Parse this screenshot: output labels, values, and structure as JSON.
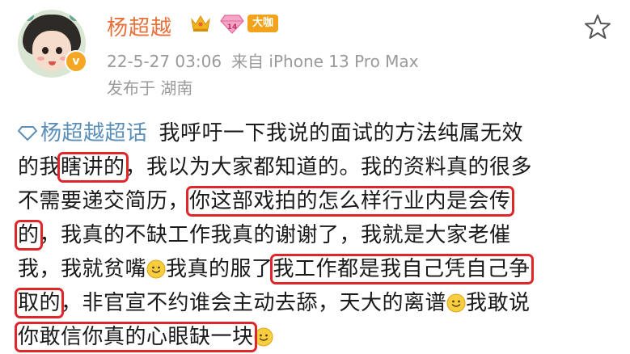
{
  "user": {
    "name": "杨超越",
    "vip_badge": "大咖",
    "level_badge": "14",
    "verified_mark": "v"
  },
  "meta": {
    "timestamp": "22-5-27 03:06",
    "source": "来自 iPhone 13 Pro Max",
    "location": "发布于 湖南"
  },
  "post": {
    "topic": "杨超越超话",
    "lines": [
      [
        "我呼吁一下我说的面试的方法纯属无效"
      ],
      [
        "的我",
        "瞎讲的",
        "，我以为大家都知道的。我的资料真的很多"
      ],
      [
        "不需要递交简历，",
        "你这部戏拍的怎么样行业内是会传"
      ],
      [
        "的",
        "，我真的不缺工作我真的谢谢了，我就是大家老催"
      ],
      [
        "我，我就贫嘴",
        "我真的服了",
        "我工作都是我自己凭自己争"
      ],
      [
        "取的",
        "，非官宣不约谁会主动去舔，天大的离谱",
        "我敢说"
      ],
      [
        "你敢信你真的心眼缺一块"
      ]
    ]
  },
  "colors": {
    "username": "#e8713a",
    "topic": "#5b8fb9",
    "highlight_box": "#e0262a",
    "meta_text": "#9a9a9a"
  },
  "icons": {
    "favorite": "star-outline-icon",
    "topic": "diamond-icon",
    "emoji": "smile-emoji-icon"
  }
}
